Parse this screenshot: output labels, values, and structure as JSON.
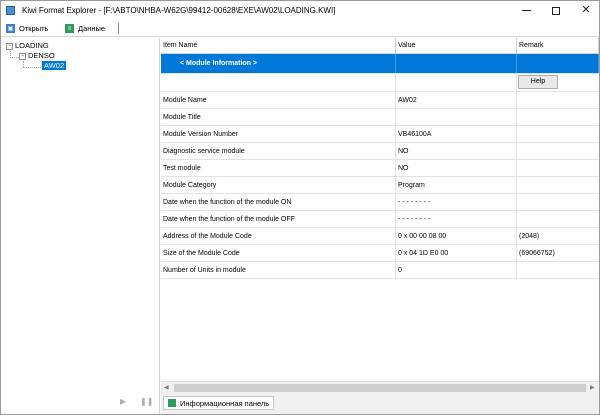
{
  "window": {
    "title": "Kiwi Format Explorer - [F:\\ABTO\\NHBA-W62G\\99412-00628\\EXE\\AW02\\LOADING.KWI]",
    "icon": "app-icon"
  },
  "toolbar": {
    "open_label": "Открыть",
    "data_label": "Данные"
  },
  "tree": {
    "root": "LOADING",
    "child": "DENSO",
    "leaf": "AW02"
  },
  "grid": {
    "headers": [
      "Item Name",
      "Value",
      "Remark"
    ],
    "section_title": "< Module Information >",
    "help_label": "Help",
    "rows": [
      {
        "name": "Module Name",
        "value": "AW02",
        "remark": ""
      },
      {
        "name": "Module Title",
        "value": "",
        "remark": ""
      },
      {
        "name": "Module Version Number",
        "value": "VB46100A",
        "remark": ""
      },
      {
        "name": "Diagnostic service module",
        "value": "NO",
        "remark": ""
      },
      {
        "name": "Test module",
        "value": "NO",
        "remark": ""
      },
      {
        "name": "Module Category",
        "value": "Program",
        "remark": ""
      },
      {
        "name": "Date when the function of the module ON",
        "value": "- - - - - - - -",
        "remark": ""
      },
      {
        "name": "Date when the function of the module OFF",
        "value": "- - - - - - - -",
        "remark": ""
      },
      {
        "name": "Address of the Module Code",
        "value": "0 x 00 00 08 00",
        "remark": "(2048)"
      },
      {
        "name": "Size of the Module Code",
        "value": "0 x 04 1D E0 00",
        "remark": "(69066752)"
      },
      {
        "name": "Number of Units in module",
        "value": "0",
        "remark": ""
      }
    ]
  },
  "status": {
    "panel_tab": "Информационная панель"
  },
  "colors": {
    "selection": "#0078d7"
  }
}
